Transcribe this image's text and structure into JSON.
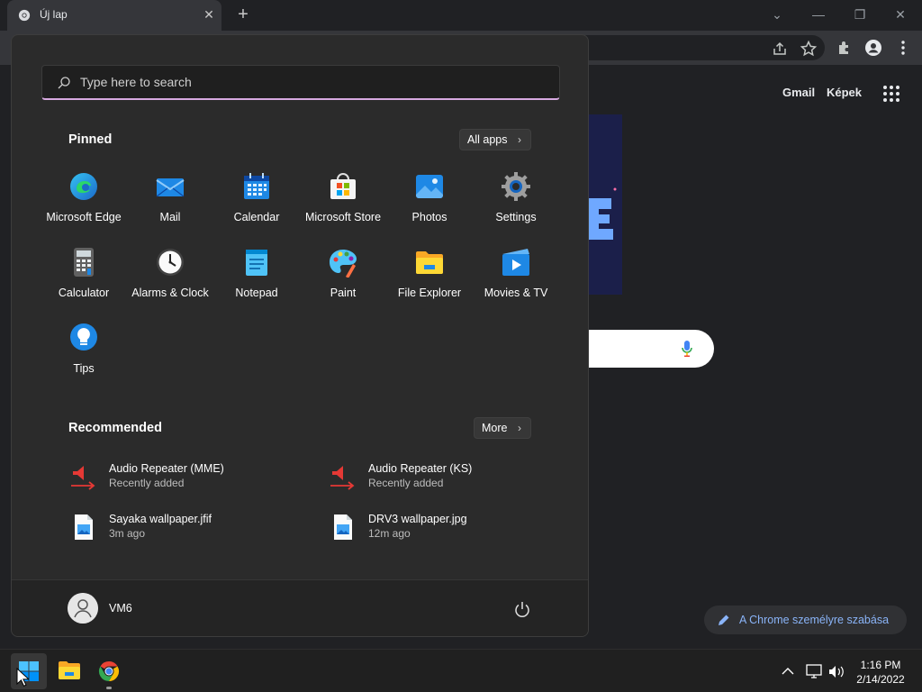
{
  "browser": {
    "tab_title": "Új lap",
    "close_symbol": "✕",
    "new_tab_symbol": "+",
    "controls": {
      "dropdown": "⌄",
      "minimize": "—",
      "restore": "❐",
      "close": "✕"
    },
    "ntp": {
      "gmail": "Gmail",
      "images": "Képek",
      "customize_label": "A Chrome személyre szabása"
    }
  },
  "start_menu": {
    "search_placeholder": "Type here to search",
    "pinned_title": "Pinned",
    "all_apps_label": "All apps",
    "pinned": [
      {
        "label": "Microsoft Edge",
        "icon": "edge-icon"
      },
      {
        "label": "Mail",
        "icon": "mail-icon"
      },
      {
        "label": "Calendar",
        "icon": "calendar-icon"
      },
      {
        "label": "Microsoft Store",
        "icon": "store-icon"
      },
      {
        "label": "Photos",
        "icon": "photos-icon"
      },
      {
        "label": "Settings",
        "icon": "gear-icon"
      },
      {
        "label": "Calculator",
        "icon": "calculator-icon"
      },
      {
        "label": "Alarms & Clock",
        "icon": "clock-icon"
      },
      {
        "label": "Notepad",
        "icon": "notepad-icon"
      },
      {
        "label": "Paint",
        "icon": "paint-icon"
      },
      {
        "label": "File Explorer",
        "icon": "folder-icon"
      },
      {
        "label": "Movies & TV",
        "icon": "movies-icon"
      },
      {
        "label": "Tips",
        "icon": "lightbulb-icon"
      }
    ],
    "recommended_title": "Recommended",
    "more_label": "More",
    "recommended": [
      {
        "name": "Audio Repeater (MME)",
        "detail": "Recently added",
        "icon": "audio-repeater-icon"
      },
      {
        "name": "Audio Repeater (KS)",
        "detail": "Recently added",
        "icon": "audio-repeater-icon"
      },
      {
        "name": "Sayaka wallpaper.jfif",
        "detail": "3m ago",
        "icon": "image-file-icon"
      },
      {
        "name": "DRV3 wallpaper.jpg",
        "detail": "12m ago",
        "icon": "image-file-icon"
      }
    ],
    "user_name": "VM6"
  },
  "taskbar": {
    "time": "1:16 PM",
    "date": "2/14/2022"
  },
  "colors": {
    "start_bg": "#2b2b2b",
    "accent_underline": "#d7a9e0",
    "taskbar_bg": "#202020",
    "link_blue": "#8ab4f8"
  }
}
